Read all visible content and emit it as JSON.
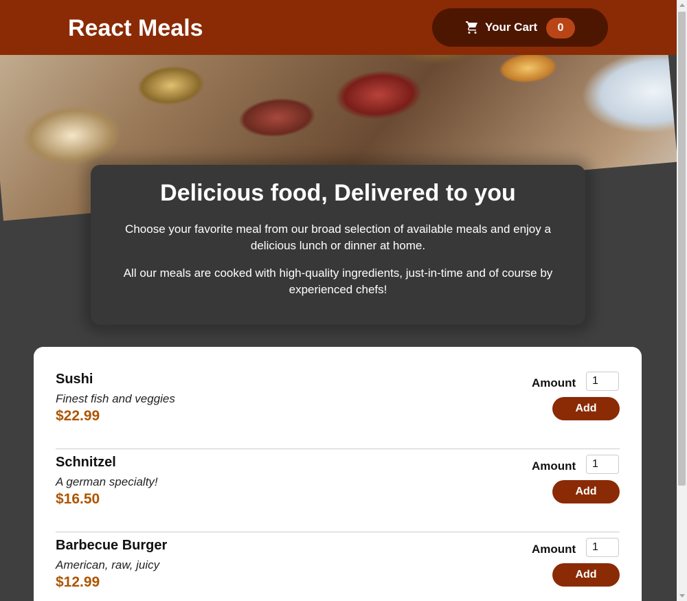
{
  "header": {
    "brand": "React Meals",
    "cart": {
      "label": "Your Cart",
      "count": "0",
      "icon": "cart-icon"
    }
  },
  "summary": {
    "title": "Delicious food, Delivered to you",
    "paragraph1": "Choose your favorite meal from our broad selection of available meals and enjoy a delicious lunch or dinner at home.",
    "paragraph2": "All our meals are cooked with high-quality ingredients, just-in-time and of course by experienced chefs!"
  },
  "meals": [
    {
      "name": "Sushi",
      "description": "Finest fish and veggies",
      "price": "$22.99",
      "amount_label": "Amount",
      "amount_value": "1",
      "add_label": "Add"
    },
    {
      "name": "Schnitzel",
      "description": "A german specialty!",
      "price": "$16.50",
      "amount_label": "Amount",
      "amount_value": "1",
      "add_label": "Add"
    },
    {
      "name": "Barbecue Burger",
      "description": "American, raw, juicy",
      "price": "$12.99",
      "amount_label": "Amount",
      "amount_value": "1",
      "add_label": "Add"
    }
  ],
  "colors": {
    "header": "#8a2b06",
    "cart_button": "#4d1601",
    "badge": "#b94517",
    "price": "#ad5502",
    "background": "#3f3f3f"
  }
}
